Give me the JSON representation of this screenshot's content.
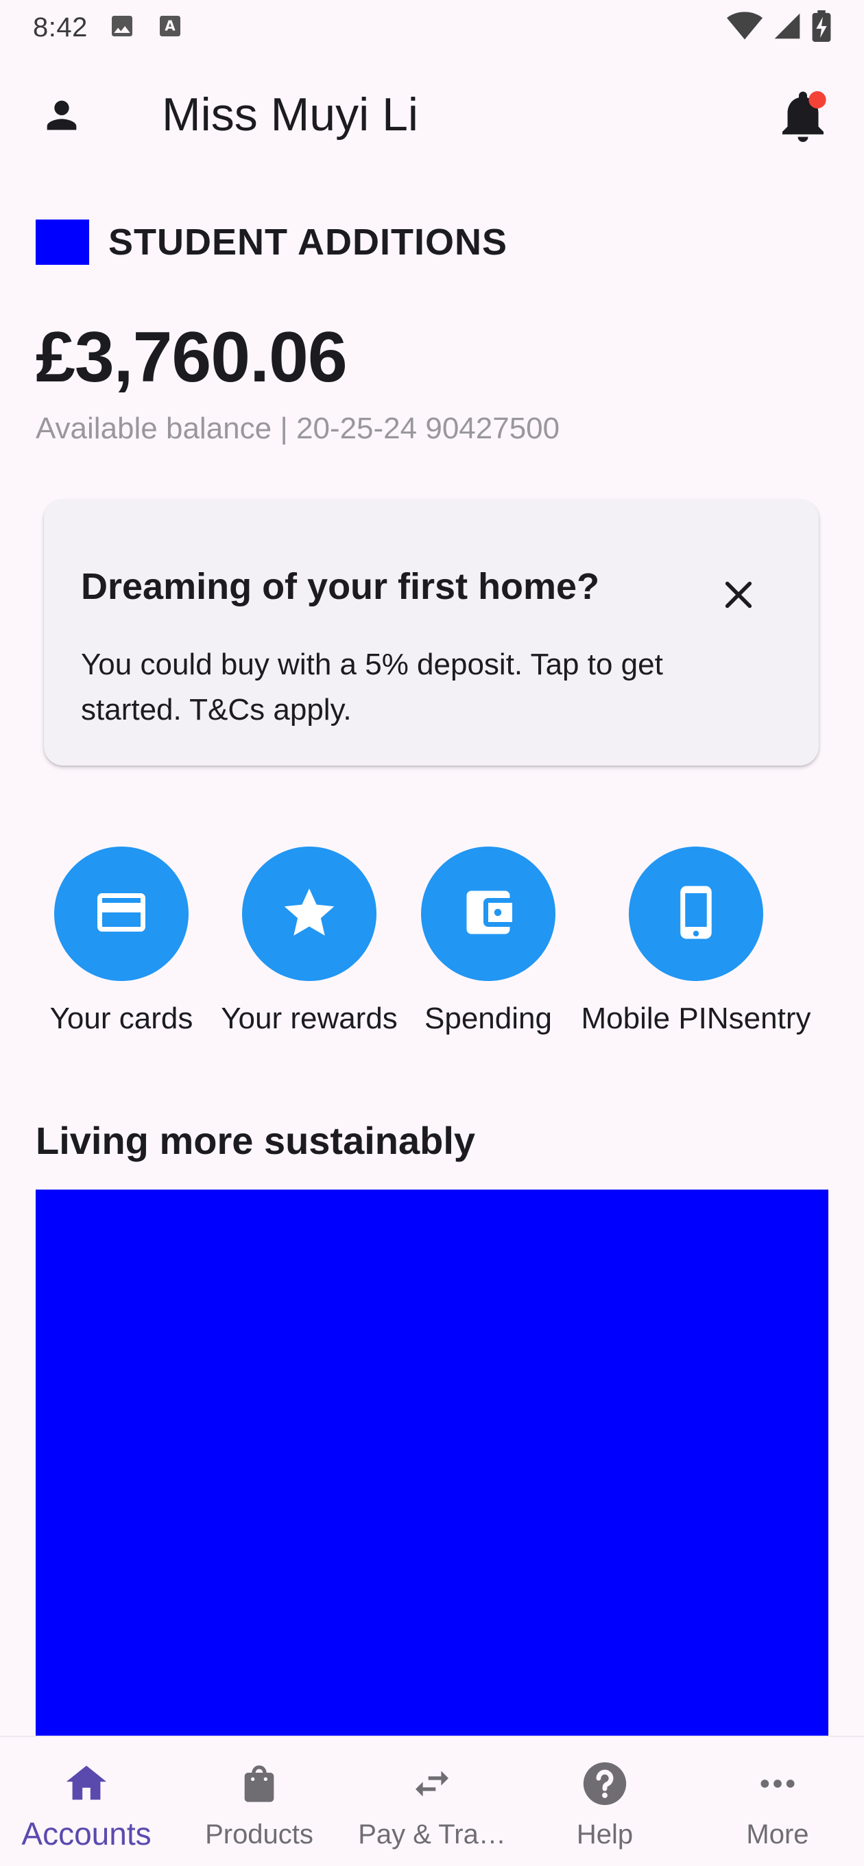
{
  "status_bar": {
    "time": "8:42",
    "icons": [
      "image-icon",
      "a-icon",
      "wifi-icon",
      "signal-icon",
      "battery-charging-icon"
    ]
  },
  "header": {
    "user_name": "Miss Muyi Li",
    "notification_dot_color": "#F44336",
    "icons": [
      "person-icon",
      "bell-icon"
    ]
  },
  "account": {
    "name": "STUDENT ADDITIONS",
    "swatch_color": "#0000FF",
    "balance": "£3,760.06",
    "subtitle": "Available balance | 20-25-24 90427500"
  },
  "promo_card": {
    "title": "Dreaming of your first home?",
    "body": "You could buy with a 5% deposit. Tap to get started. T&Cs apply.",
    "close_icon": "close-icon"
  },
  "quick_actions": [
    {
      "label": "Your cards",
      "icon": "credit-card-icon"
    },
    {
      "label": "Your rewards",
      "icon": "star-icon"
    },
    {
      "label": "Spending",
      "icon": "wallet-icon"
    },
    {
      "label": "Mobile PINsentry",
      "icon": "smartphone-icon"
    }
  ],
  "quick_action_color": "#2196F3",
  "section": {
    "title": "Living more sustainably",
    "image_color": "#0000FF"
  },
  "bottom_nav": {
    "active_color": "#5A4AAE",
    "items": [
      {
        "label": "Accounts",
        "icon": "home-icon",
        "active": true
      },
      {
        "label": "Products",
        "icon": "shopping-bag-icon",
        "active": false
      },
      {
        "label": "Pay & Tra…",
        "icon": "swap-arrows-icon",
        "active": false
      },
      {
        "label": "Help",
        "icon": "help-icon",
        "active": false
      },
      {
        "label": "More",
        "icon": "more-horizontal-icon",
        "active": false
      }
    ]
  }
}
